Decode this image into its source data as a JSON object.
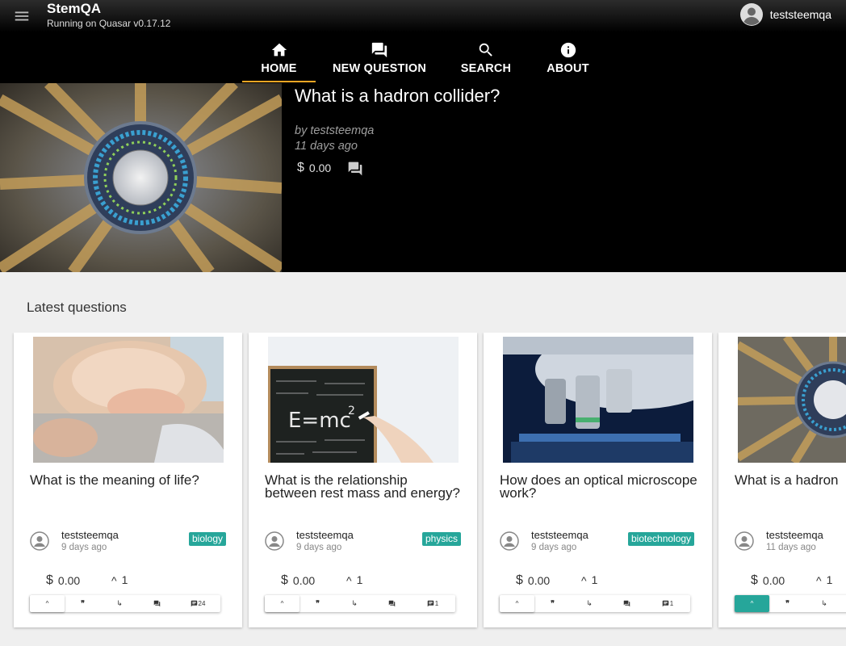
{
  "header": {
    "title": "StemQA",
    "subtitle": "Running on Quasar v0.17.12",
    "menu_icon": "menu-icon",
    "user": {
      "name": "teststeemqa",
      "avatar_icon": "account-circle-icon"
    }
  },
  "tabs": [
    {
      "label": "HOME",
      "icon": "home-icon",
      "active": true
    },
    {
      "label": "NEW QUESTION",
      "icon": "forum-icon",
      "active": false
    },
    {
      "label": "SEARCH",
      "icon": "search-icon",
      "active": false
    },
    {
      "label": "ABOUT",
      "icon": "info-icon",
      "active": false
    }
  ],
  "hero": {
    "title": "What is a hadron collider?",
    "by": "by teststeemqa",
    "time": "11 days ago",
    "payout": "0.00",
    "currency": "$",
    "comment_icon": "comment-icon",
    "image": "hadron-collider-photo"
  },
  "latest": {
    "heading": "Latest questions",
    "cards": [
      {
        "title": "What is the meaning of life?",
        "author": "teststeemqa",
        "time": "9 days ago",
        "tag": "biology",
        "payout": "0.00",
        "currency": "$",
        "votes": "1",
        "comments": "24",
        "voted": false,
        "image": "sleeping-baby-photo"
      },
      {
        "title": "What is the relationship between rest mass and energy?",
        "author": "teststeemqa",
        "time": "9 days ago",
        "tag": "physics",
        "payout": "0.00",
        "currency": "$",
        "votes": "1",
        "comments": "1",
        "voted": false,
        "image": "chalkboard-emc2-photo"
      },
      {
        "title": "How does an optical microscope work?",
        "author": "teststeemqa",
        "time": "9 days ago",
        "tag": "biotechnology",
        "payout": "0.00",
        "currency": "$",
        "votes": "1",
        "comments": "1",
        "voted": false,
        "image": "microscope-photo"
      },
      {
        "title": "What is a hadron",
        "author": "teststeemqa",
        "time": "11 days ago",
        "tag": "",
        "payout": "0.00",
        "currency": "$",
        "votes": "1",
        "comments": "",
        "voted": true,
        "image": "hadron-collider-photo"
      }
    ]
  },
  "colors": {
    "header_bg": "#000000",
    "accent_underline": "#f5a623",
    "tag_bg": "#26a69a",
    "page_bg": "#efefef"
  }
}
